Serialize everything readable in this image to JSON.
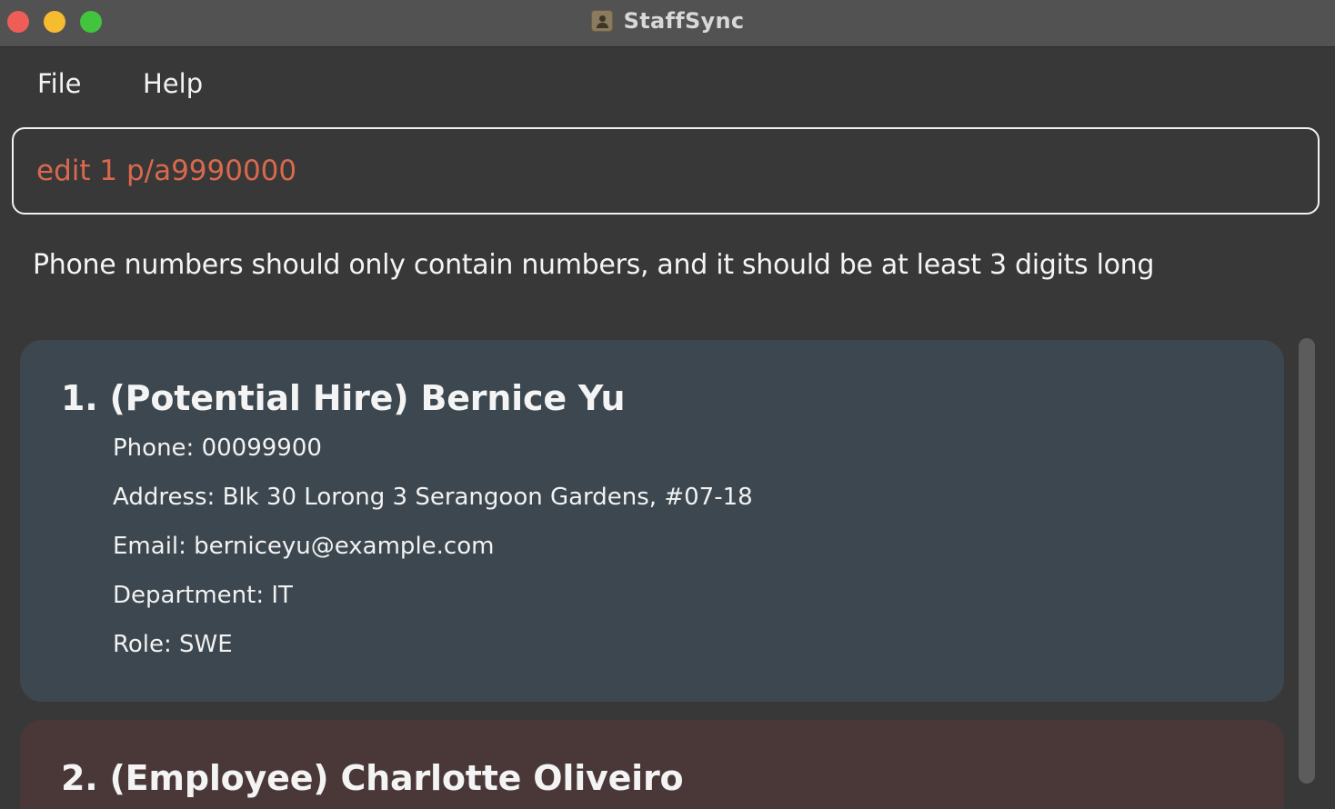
{
  "window": {
    "title": "StaffSync",
    "icon": "address-book-icon",
    "controls": [
      "close",
      "minimize",
      "maximize"
    ],
    "colors": {
      "close": "#ee5e56",
      "minimize": "#f5bc30",
      "maximize": "#42c43f"
    }
  },
  "menu": {
    "file": "File",
    "help": "Help"
  },
  "command": {
    "value": "edit 1 p/a9990000",
    "text_color": "#d9694e"
  },
  "result": {
    "message": "Phone numbers should only contain numbers, and it should be at least 3 digits long"
  },
  "persons": [
    {
      "header": "1. (Potential Hire) Bernice Yu",
      "phone": "Phone: 00099900",
      "address": "Address: Blk 30 Lorong 3 Serangoon Gardens, #07-18",
      "email": "Email: berniceyu@example.com",
      "department": "Department: IT",
      "role": "Role: SWE",
      "card_color": "#3c474f"
    },
    {
      "header": "2. (Employee) Charlotte Oliveiro",
      "card_color": "#4a3839"
    }
  ]
}
